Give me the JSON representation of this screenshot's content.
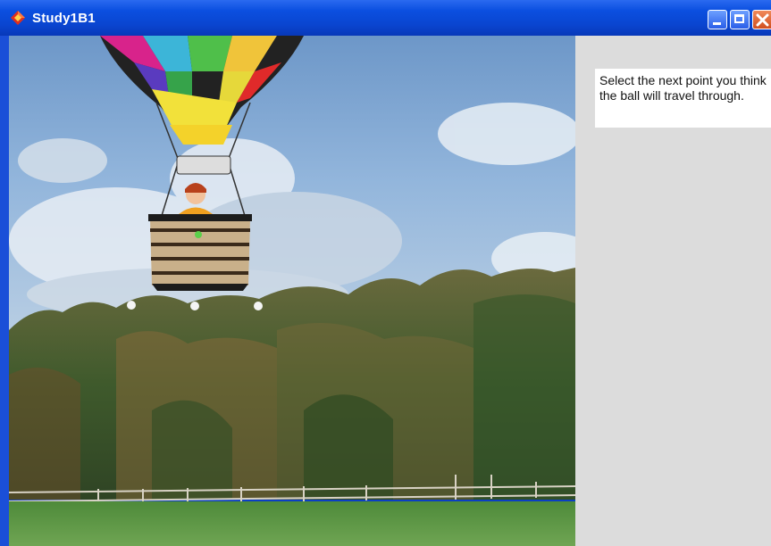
{
  "window": {
    "title": "Study1B1",
    "icon": "app-diamond-icon",
    "controls": [
      "minimize-icon",
      "maximize-icon",
      "close-icon"
    ]
  },
  "panel": {
    "prompt": "Select the next point you think the ball will travel through."
  },
  "scene": {
    "description_icons": [
      "hot-air-balloon",
      "pilot",
      "target-points"
    ],
    "target_point_count": 3
  }
}
